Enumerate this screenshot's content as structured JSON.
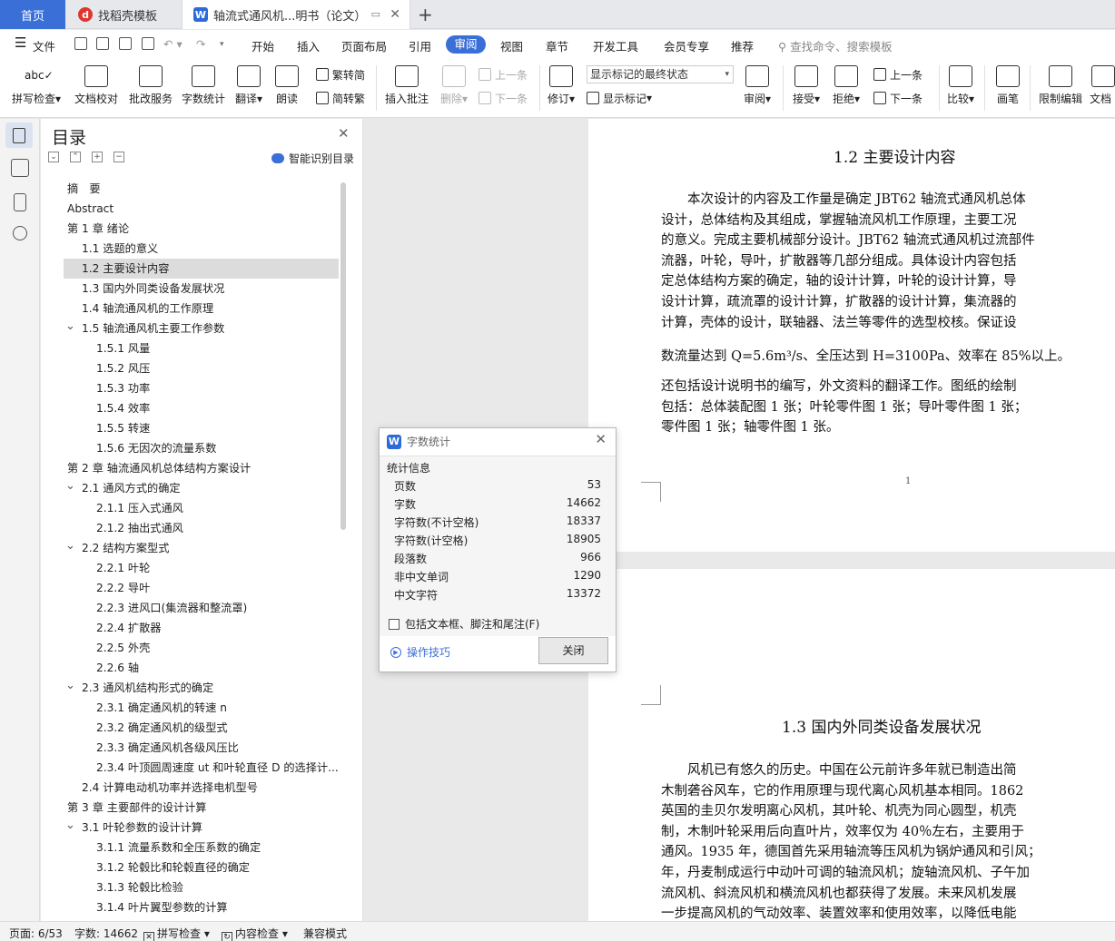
{
  "tabs": {
    "home": "首页",
    "template": "找稻壳模板",
    "document": "轴流式通风机...明书（论文）",
    "add_icon": "plus-icon"
  },
  "menubar": {
    "file": "文件",
    "items": [
      "开始",
      "插入",
      "页面布局",
      "引用",
      "审阅",
      "视图",
      "章节",
      "开发工具",
      "会员专享",
      "推荐"
    ],
    "active": "审阅",
    "search_placeholder": "查找命令、搜索模板"
  },
  "ribbon": {
    "spell_check": "拼写检查",
    "doc_proofread": "文档校对",
    "batch_service": "批改服务",
    "word_count": "字数统计",
    "translate": "翻译",
    "read_aloud": "朗读",
    "to_traditional": "繁转简",
    "to_simplified": "简转繁",
    "insert_comment": "插入批注",
    "delete": "删除",
    "prev_comment": "上一条",
    "next_comment": "下一条",
    "track_changes": "修订",
    "markup_state": "显示标记的最终状态",
    "show_markup": "显示标记",
    "review": "审阅",
    "accept": "接受",
    "reject": "拒绝",
    "prev_change": "上一条",
    "next_change": "下一条",
    "compare": "比较",
    "pen": "画笔",
    "restrict_edit": "限制编辑",
    "doc_more": "文档"
  },
  "toc": {
    "title": "目录",
    "smart_label": "智能识别目录",
    "items": [
      {
        "label": "摘　要",
        "level": 0,
        "caret": false
      },
      {
        "label": "Abstract",
        "level": 0,
        "caret": false
      },
      {
        "label": "第 1 章 绪论",
        "level": 0,
        "caret": true
      },
      {
        "label": "1.1 选题的意义",
        "level": 1,
        "caret": false
      },
      {
        "label": "1.2 主要设计内容",
        "level": 1,
        "caret": false,
        "selected": true
      },
      {
        "label": "1.3 国内外同类设备发展状况",
        "level": 1,
        "caret": false
      },
      {
        "label": "1.4 轴流通风机的工作原理",
        "level": 1,
        "caret": false
      },
      {
        "label": "1.5 轴流通风机主要工作参数",
        "level": 1,
        "caret": true
      },
      {
        "label": "1.5.1 风量",
        "level": 2,
        "caret": false
      },
      {
        "label": "1.5.2 风压",
        "level": 2,
        "caret": false
      },
      {
        "label": "1.5.3 功率",
        "level": 2,
        "caret": false
      },
      {
        "label": "1.5.4 效率",
        "level": 2,
        "caret": false
      },
      {
        "label": "1.5.5 转速",
        "level": 2,
        "caret": false
      },
      {
        "label": "1.5.6 无因次的流量系数",
        "level": 2,
        "caret": false
      },
      {
        "label": "第 2 章 轴流通风机总体结构方案设计",
        "level": 0,
        "caret": true
      },
      {
        "label": "2.1 通风方式的确定",
        "level": 1,
        "caret": true
      },
      {
        "label": "2.1.1 压入式通风",
        "level": 2,
        "caret": false
      },
      {
        "label": "2.1.2 抽出式通风",
        "level": 2,
        "caret": false
      },
      {
        "label": "2.2 结构方案型式",
        "level": 1,
        "caret": true
      },
      {
        "label": "2.2.1 叶轮",
        "level": 2,
        "caret": false
      },
      {
        "label": "2.2.2 导叶",
        "level": 2,
        "caret": false
      },
      {
        "label": "2.2.3 进风口(集流器和整流罩)",
        "level": 2,
        "caret": false
      },
      {
        "label": "2.2.4 扩散器",
        "level": 2,
        "caret": false
      },
      {
        "label": "2.2.5 外壳",
        "level": 2,
        "caret": false
      },
      {
        "label": "2.2.6 轴",
        "level": 2,
        "caret": false
      },
      {
        "label": "2.3 通风机结构形式的确定",
        "level": 1,
        "caret": true
      },
      {
        "label": "2.3.1 确定通风机的转速 n",
        "level": 2,
        "caret": false
      },
      {
        "label": "2.3.2 确定通风机的级型式",
        "level": 2,
        "caret": false
      },
      {
        "label": "2.3.3 确定通风机各级风压比",
        "level": 2,
        "caret": false
      },
      {
        "label": "2.3.4 叶顶圆周速度 ut 和叶轮直径 D 的选择计...",
        "level": 2,
        "caret": false
      },
      {
        "label": "2.4 计算电动机功率并选择电机型号",
        "level": 1,
        "caret": false
      },
      {
        "label": "第 3 章 主要部件的设计计算",
        "level": 0,
        "caret": true
      },
      {
        "label": "3.1 叶轮参数的设计计算",
        "level": 1,
        "caret": true
      },
      {
        "label": "3.1.1 流量系数和全压系数的确定",
        "level": 2,
        "caret": false
      },
      {
        "label": "3.1.2 轮毂比和轮毂直径的确定",
        "level": 2,
        "caret": false
      },
      {
        "label": "3.1.3 轮毂比检验",
        "level": 2,
        "caret": false
      },
      {
        "label": "3.1.4 叶片翼型参数的计算",
        "level": 2,
        "caret": false
      }
    ]
  },
  "document": {
    "heading1": "1.2 主要设计内容",
    "para1": [
      "　　本次设计的内容及工作量是确定 JBT62 轴流式通风机总体",
      "设计，总体结构及其组成，掌握轴流风机工作原理，主要工况",
      "的意义。完成主要机械部分设计。JBT62 轴流式通风机过流部件",
      "流器，叶轮，导叶，扩散器等几部分组成。具体设计内容包括",
      "定总体结构方案的确定，轴的设计计算，叶轮的设计计算，导",
      "设计计算，疏流罩的设计计算，扩散器的设计计算，集流器的",
      "计算，壳体的设计，联轴器、法兰等零件的选型校核。保证设"
    ],
    "flow_line": "数流量达到 Q=5.6m³/s、全压达到 H=3100Pa、效率在 85%以上。",
    "para2": [
      "还包括设计说明书的编写，外文资料的翻译工作。图纸的绘制",
      "包括：总体装配图 1 张；叶轮零件图 1 张；导叶零件图 1 张；",
      "零件图 1 张；轴零件图 1 张。"
    ],
    "page_number": "1",
    "heading2": "1.3 国内外同类设备发展状况",
    "para3": [
      "　　风机已有悠久的历史。中国在公元前许多年就已制造出简",
      "木制砻谷风车，它的作用原理与现代离心风机基本相同。1862",
      "英国的圭贝尔发明离心风机，其叶轮、机壳为同心圆型，机壳",
      "制，木制叶轮采用后向直叶片，效率仅为 40％左右，主要用于",
      "通风。1935 年，德国首先采用轴流等压风机为锅炉通风和引风；",
      "年，丹麦制成运行中动叶可调的轴流风机；旋轴流风机、子午加",
      "流风机、斜流风机和横流风机也都获得了发展。未来风机发展",
      "一步提高风机的气动效率、装置效率和使用效率，以降低电能"
    ]
  },
  "dialog": {
    "title": "字数统计",
    "section": "统计信息",
    "stats": [
      {
        "label": "页数",
        "value": "53"
      },
      {
        "label": "字数",
        "value": "14662"
      },
      {
        "label": "字符数(不计空格)",
        "value": "18337"
      },
      {
        "label": "字符数(计空格)",
        "value": "18905"
      },
      {
        "label": "段落数",
        "value": "966"
      },
      {
        "label": "非中文单词",
        "value": "1290"
      },
      {
        "label": "中文字符",
        "value": "13372"
      }
    ],
    "include_label": "包括文本框、脚注和尾注(F)",
    "include_checked": false,
    "tips": "操作技巧",
    "close": "关闭"
  },
  "statusbar": {
    "page": "页面: 6/53",
    "words": "字数: 14662",
    "spell": "拼写检查",
    "content_check": "内容检查",
    "compat": "兼容模式"
  }
}
